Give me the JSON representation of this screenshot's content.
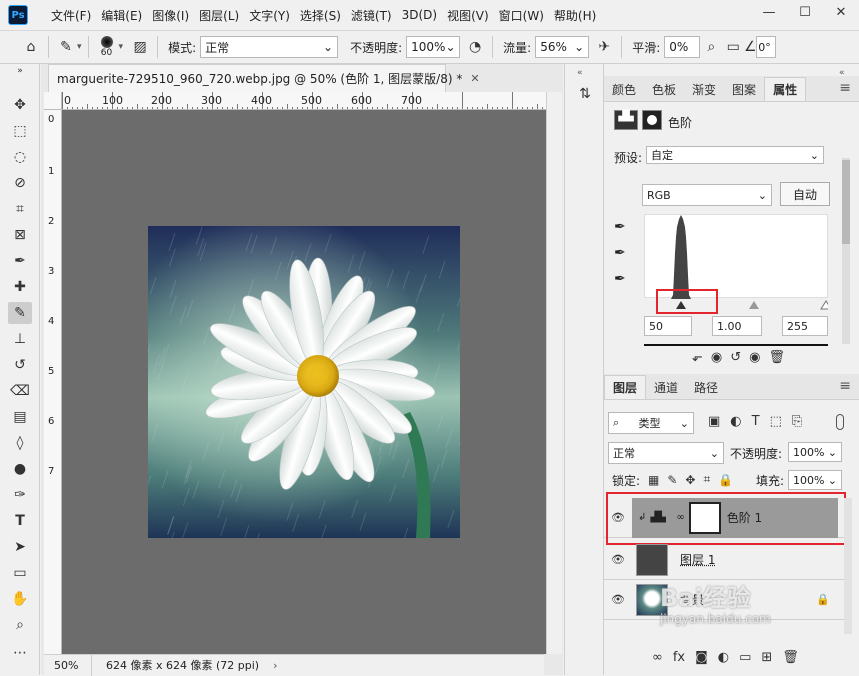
{
  "app": {
    "logo": "Ps"
  },
  "menu": [
    "文件(F)",
    "编辑(E)",
    "图像(I)",
    "图层(L)",
    "文字(Y)",
    "选择(S)",
    "滤镜(T)",
    "3D(D)",
    "视图(V)",
    "窗口(W)",
    "帮助(H)"
  ],
  "window_controls": {
    "minimize": "—",
    "restore": "☐",
    "close": "✕"
  },
  "options": {
    "brush_size": "60",
    "mode_label": "模式:",
    "mode_value": "正常",
    "opacity_label": "不透明度:",
    "opacity_value": "100%",
    "flow_label": "流量:",
    "flow_value": "56%",
    "smooth_label": "平滑:",
    "smooth_value": "0%",
    "angle_value": "0°"
  },
  "document": {
    "tab_title": "marguerite-729510_960_720.webp.jpg @ 50% (色阶 1, 图层蒙版/8) *",
    "zoom": "50%",
    "doc_info": "624 像素 x 624 像素 (72 ppi)"
  },
  "ruler_top": [
    "0",
    "100",
    "200",
    "300",
    "400",
    "500",
    "600",
    "700"
  ],
  "ruler_left": [
    "0",
    "1",
    "2",
    "3",
    "4",
    "5",
    "6",
    "7"
  ],
  "properties_panel": {
    "tabs": [
      "颜色",
      "色板",
      "渐变",
      "图案",
      "属性"
    ],
    "active_tab": "属性",
    "adjustment_title": "色阶",
    "preset_label": "预设:",
    "preset_value": "自定",
    "channel_value": "RGB",
    "auto_button": "自动",
    "input_black": "50",
    "input_gamma": "1.00",
    "input_white": "255"
  },
  "layers_panel": {
    "tabs": [
      "图层",
      "通道",
      "路径"
    ],
    "filter_label": "类型",
    "blend_mode": "正常",
    "opacity_label": "不透明度:",
    "opacity_value": "100%",
    "lock_label": "锁定:",
    "fill_label": "填充:",
    "fill_value": "100%",
    "layers": [
      {
        "name": "色阶 1",
        "selected": true
      },
      {
        "name": "图层 1",
        "selected": false
      },
      {
        "name": "背景",
        "selected": false
      }
    ]
  },
  "watermark": {
    "brand": "Bai经验",
    "url": "jingyan.baidu.com"
  },
  "colors": {
    "highlight": "#e3262b",
    "canvas_bg": "#6c6c6c",
    "selected_layer": "#9a9a9a"
  }
}
